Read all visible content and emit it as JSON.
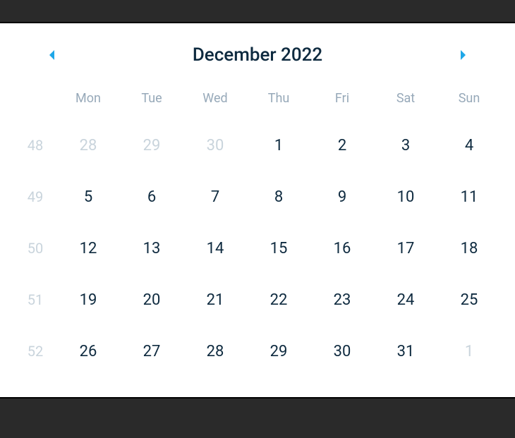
{
  "header": {
    "title": "December 2022"
  },
  "dayHeaders": [
    "Mon",
    "Tue",
    "Wed",
    "Thu",
    "Fri",
    "Sat",
    "Sun"
  ],
  "weeks": [
    {
      "wk": "48",
      "days": [
        {
          "d": "28",
          "other": true
        },
        {
          "d": "29",
          "other": true
        },
        {
          "d": "30",
          "other": true
        },
        {
          "d": "1",
          "other": false
        },
        {
          "d": "2",
          "other": false
        },
        {
          "d": "3",
          "other": false
        },
        {
          "d": "4",
          "other": false
        }
      ]
    },
    {
      "wk": "49",
      "days": [
        {
          "d": "5",
          "other": false
        },
        {
          "d": "6",
          "other": false
        },
        {
          "d": "7",
          "other": false
        },
        {
          "d": "8",
          "other": false
        },
        {
          "d": "9",
          "other": false
        },
        {
          "d": "10",
          "other": false
        },
        {
          "d": "11",
          "other": false
        }
      ]
    },
    {
      "wk": "50",
      "days": [
        {
          "d": "12",
          "other": false
        },
        {
          "d": "13",
          "other": false
        },
        {
          "d": "14",
          "other": false
        },
        {
          "d": "15",
          "other": false
        },
        {
          "d": "16",
          "other": false
        },
        {
          "d": "17",
          "other": false
        },
        {
          "d": "18",
          "other": false
        }
      ]
    },
    {
      "wk": "51",
      "days": [
        {
          "d": "19",
          "other": false
        },
        {
          "d": "20",
          "other": false
        },
        {
          "d": "21",
          "other": false
        },
        {
          "d": "22",
          "other": false
        },
        {
          "d": "23",
          "other": false
        },
        {
          "d": "24",
          "other": false
        },
        {
          "d": "25",
          "other": false
        }
      ]
    },
    {
      "wk": "52",
      "days": [
        {
          "d": "26",
          "other": false
        },
        {
          "d": "27",
          "other": false
        },
        {
          "d": "28",
          "other": false
        },
        {
          "d": "29",
          "other": false
        },
        {
          "d": "30",
          "other": false
        },
        {
          "d": "31",
          "other": false
        },
        {
          "d": "1",
          "other": true
        }
      ]
    }
  ]
}
